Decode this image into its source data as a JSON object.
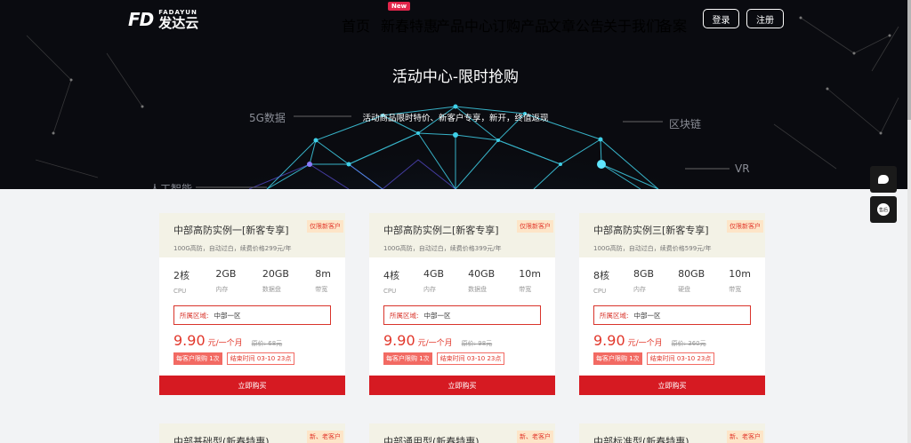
{
  "header": {
    "logo_mark": "FD",
    "logo_en": "FADAYUN",
    "logo_cn": "发达云",
    "nav": [
      "首页",
      "新春特惠",
      "产品中心",
      "订购产品",
      "文章公告",
      "关于我们",
      "备案"
    ],
    "nav_badge": "New",
    "login": "登录",
    "register": "注册"
  },
  "hero": {
    "title": "活动中心-限时抢购",
    "subtitle": "活动商品限时特价、新客户专享，新开，终值返现",
    "tags": [
      "5G数据",
      "区块链",
      "VR",
      "人工智能"
    ]
  },
  "side": {
    "btn2": "售后"
  },
  "cards": [
    {
      "title": "中部高防实例一[新客专享]",
      "flag": "仅限新客户",
      "desc": "100G高防，自动过白，续费价格299元/年",
      "specs": [
        {
          "v": "2核",
          "l": "CPU"
        },
        {
          "v": "2GB",
          "l": "内存"
        },
        {
          "v": "20GB",
          "l": "数据盘"
        },
        {
          "v": "8m",
          "l": "带宽"
        }
      ],
      "region_label": "所属区域:",
      "region": "中部一区",
      "price": "9.90",
      "unit": "元/一个月",
      "orig": "原价: 68元",
      "limit": "每客户限购 1次",
      "end": "结束时间 03-10 23点",
      "buy": "立即购买"
    },
    {
      "title": "中部高防实例二[新客专享]",
      "flag": "仅限新客户",
      "desc": "100G高防，自动过白，续费价格399元/年",
      "specs": [
        {
          "v": "4核",
          "l": "CPU"
        },
        {
          "v": "4GB",
          "l": "内存"
        },
        {
          "v": "40GB",
          "l": "数据盘"
        },
        {
          "v": "10m",
          "l": "带宽"
        }
      ],
      "region_label": "所属区域:",
      "region": "中部一区",
      "price": "9.90",
      "unit": "元/一个月",
      "orig": "原价: 98元",
      "limit": "每客户限购 1次",
      "end": "结束时间 03-10 23点",
      "buy": "立即购买"
    },
    {
      "title": "中部高防实例三[新客专享]",
      "flag": "仅限新客户",
      "desc": "100G高防，自动过白，续费价格599元/年",
      "specs": [
        {
          "v": "8核",
          "l": "CPU"
        },
        {
          "v": "8GB",
          "l": "内存"
        },
        {
          "v": "80GB",
          "l": "硬盘"
        },
        {
          "v": "10m",
          "l": "带宽"
        }
      ],
      "region_label": "所属区域:",
      "region": "中部一区",
      "price": "9.90",
      "unit": "元/一个月",
      "orig": "原价: 360元",
      "limit": "每客户限购 1次",
      "end": "结束时间 03-10 23点",
      "buy": "立即购买"
    }
  ],
  "cards_row2": [
    {
      "title": "中部基础型(新春特惠)",
      "flag": "新、老客户"
    },
    {
      "title": "中部通用型(新春特惠)",
      "flag": "新、老客户"
    },
    {
      "title": "中部标准型(新春特惠)",
      "flag": "新、老客户"
    }
  ]
}
